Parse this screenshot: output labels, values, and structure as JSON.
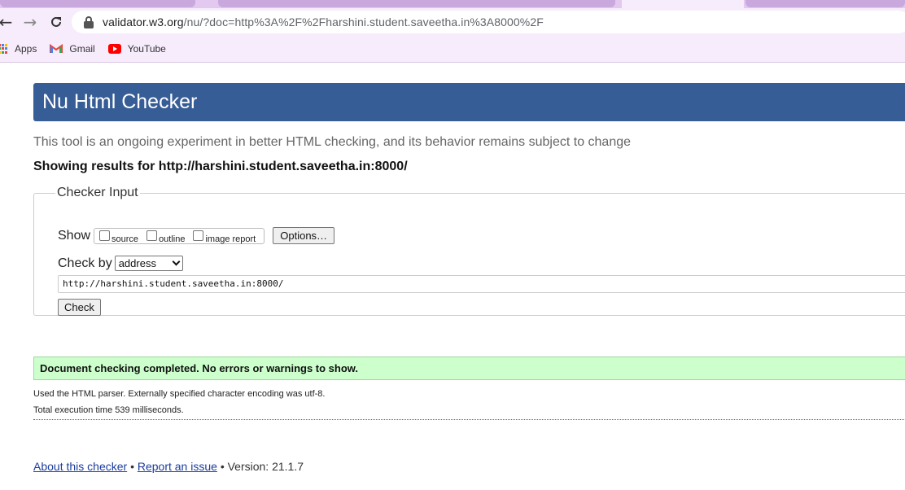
{
  "browser": {
    "url_host": "validator.w3.org",
    "url_path": "/nu/?doc=http%3A%2F%2Fharshini.student.saveetha.in%3A8000%2F",
    "bookmarks": [
      {
        "label": "Apps",
        "icon": "apps-grid-icon"
      },
      {
        "label": "Gmail",
        "icon": "gmail-icon"
      },
      {
        "label": "YouTube",
        "icon": "youtube-icon"
      }
    ]
  },
  "page": {
    "title": "Nu Html Checker",
    "tagline": "This tool is an ongoing experiment in better HTML checking, and its behavior remains subject to change",
    "results_for": "Showing results for http://harshini.student.saveetha.in:8000/"
  },
  "checker_input": {
    "legend": "Checker Input",
    "show_label": "Show",
    "options": [
      {
        "label": "source",
        "checked": false
      },
      {
        "label": "outline",
        "checked": false
      },
      {
        "label": "image report",
        "checked": false
      }
    ],
    "options_button": "Options…",
    "check_by_label": "Check by",
    "check_by_value": "address",
    "url_value": "http://harshini.student.saveetha.in:8000/",
    "check_button": "Check"
  },
  "result": {
    "message": "Document checking completed. No errors or warnings to show.",
    "parser_note": "Used the HTML parser. Externally specified character encoding was utf-8.",
    "timing": "Total execution time 539 milliseconds."
  },
  "footer": {
    "about_link": "About this checker",
    "separator": "•",
    "report_link": "Report an issue",
    "version": "• Version: 21.1.7"
  },
  "colors": {
    "banner": "#365d95",
    "success_bg": "#ccffcc",
    "chrome_bg": "#f6ecfb"
  }
}
